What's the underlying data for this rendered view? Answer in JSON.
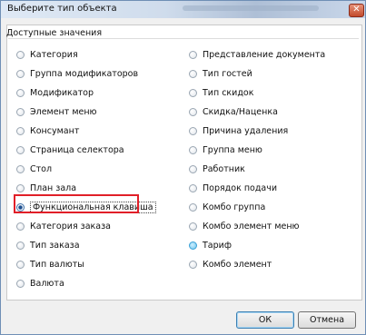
{
  "window": {
    "title": "Выберите тип объекта",
    "close_glyph": "✕"
  },
  "group": {
    "title": "Доступные значения"
  },
  "left_column": [
    "Категория",
    "Группа модификаторов",
    "Модификатор",
    "Элемент меню",
    "Консумант",
    "Страница селектора",
    "Стол",
    "План зала",
    "Функциональная клавиша",
    "Категория заказа",
    "Тип заказа",
    "Тип валюты",
    "Валюта"
  ],
  "right_column": [
    "Представление документа",
    "Тип гостей",
    "Тип скидок",
    "Скидка/Наценка",
    "Причина удаления",
    "Группа меню",
    "Работник",
    "Порядок подачи",
    "Комбо группа",
    "Комбо элемент меню",
    "Тариф",
    "Комбо элемент"
  ],
  "selected": "Функциональная клавиша",
  "hovered": "Тариф",
  "buttons": {
    "ok": "ОК",
    "cancel": "Отмена"
  },
  "colors": {
    "highlight_border": "#e11f28",
    "title_bar": "#cfdcec"
  }
}
